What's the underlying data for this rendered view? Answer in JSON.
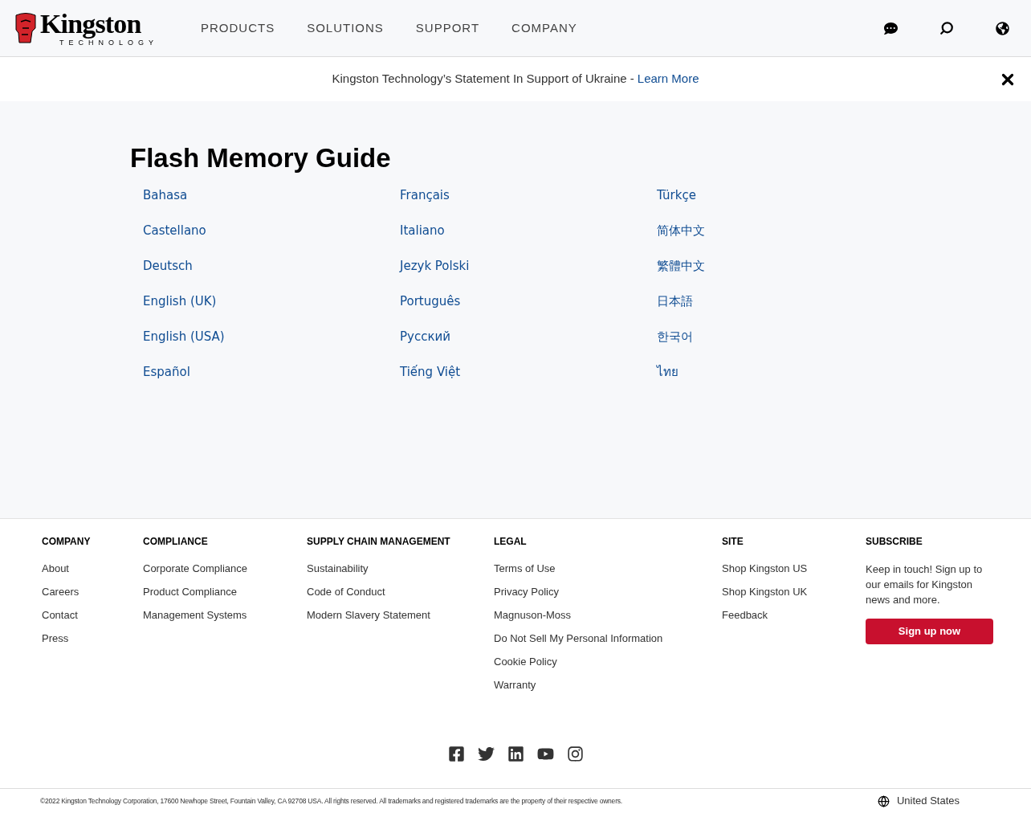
{
  "logo": {
    "wordmark": "Kingston",
    "tagline": "TECHNOLOGY"
  },
  "nav": [
    "PRODUCTS",
    "SOLUTIONS",
    "SUPPORT",
    "COMPANY"
  ],
  "banner": {
    "text": "Kingston Technology’s Statement In Support of Ukraine -",
    "link": "Learn More"
  },
  "page_title": "Flash Memory Guide",
  "languages": [
    [
      "Bahasa",
      "Castellano",
      "Deutsch",
      "English (UK)",
      "English (USA)",
      "Español"
    ],
    [
      "Français",
      "Italiano",
      "Jezyk Polski",
      "Português",
      "Русский",
      "Tiếng Việt"
    ],
    [
      "Türkçe",
      "简体中文",
      "繁體中文",
      "日本語",
      "한국어",
      "ไทย"
    ]
  ],
  "footer_columns": [
    {
      "heading": "COMPANY",
      "links": [
        "About",
        "Careers",
        "Contact",
        "Press"
      ]
    },
    {
      "heading": "COMPLIANCE",
      "links": [
        "Corporate Compliance",
        "Product Compliance",
        "Management Systems"
      ]
    },
    {
      "heading": "SUPPLY CHAIN MANAGEMENT",
      "links": [
        "Sustainability",
        "Code of Conduct",
        "Modern Slavery Statement"
      ]
    },
    {
      "heading": "LEGAL",
      "links": [
        "Terms of Use",
        "Privacy Policy",
        "Magnuson-Moss",
        "Do Not Sell My Personal Information",
        "Cookie Policy",
        "Warranty"
      ]
    },
    {
      "heading": "SITE",
      "links": [
        "Shop Kingston US",
        "Shop Kingston UK",
        "Feedback"
      ]
    }
  ],
  "subscribe": {
    "heading": "SUBSCRIBE",
    "text": "Keep in touch! Sign up to our emails for Kingston news and more.",
    "button": "Sign up now"
  },
  "social": [
    {
      "kind": "facebook"
    },
    {
      "kind": "twitter"
    },
    {
      "kind": "linkedin"
    },
    {
      "kind": "youtube"
    },
    {
      "kind": "instagram"
    }
  ],
  "copyright": "©2022 Kingston Technology Corporation, 17600 Newhope Street, Fountain Valley, CA 92708 USA. All rights reserved. All trademarks and registered trademarks are the property of their respective owners.",
  "region": "United States"
}
